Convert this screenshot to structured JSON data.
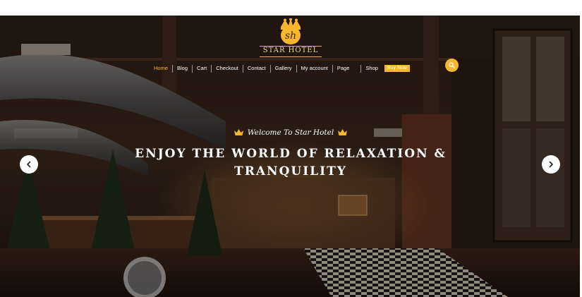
{
  "logo": {
    "monogram": "sh",
    "name": "STAR HOTEL",
    "icon": "crown-icon"
  },
  "nav": {
    "items": [
      {
        "label": "Home",
        "active": true
      },
      {
        "label": "Blog"
      },
      {
        "label": "Cart"
      },
      {
        "label": "Checkout"
      },
      {
        "label": "Contact"
      },
      {
        "label": "Gallery"
      },
      {
        "label": "My account"
      },
      {
        "label": "Page"
      },
      {
        "label": "Shop"
      }
    ],
    "buy_now": "Buy Now",
    "search_icon": "search-icon"
  },
  "hero": {
    "welcome": "Welcome To Star Hotel",
    "headline_line1": "ENJOY THE WORLD OF RELAXATION &",
    "headline_line2": "TRANQUILITY",
    "prev_icon": "chevron-left-icon",
    "next_icon": "chevron-right-icon"
  },
  "colors": {
    "accent": "#f6b62e",
    "logo_text": "#f0d9a6",
    "text": "#ffffff"
  }
}
